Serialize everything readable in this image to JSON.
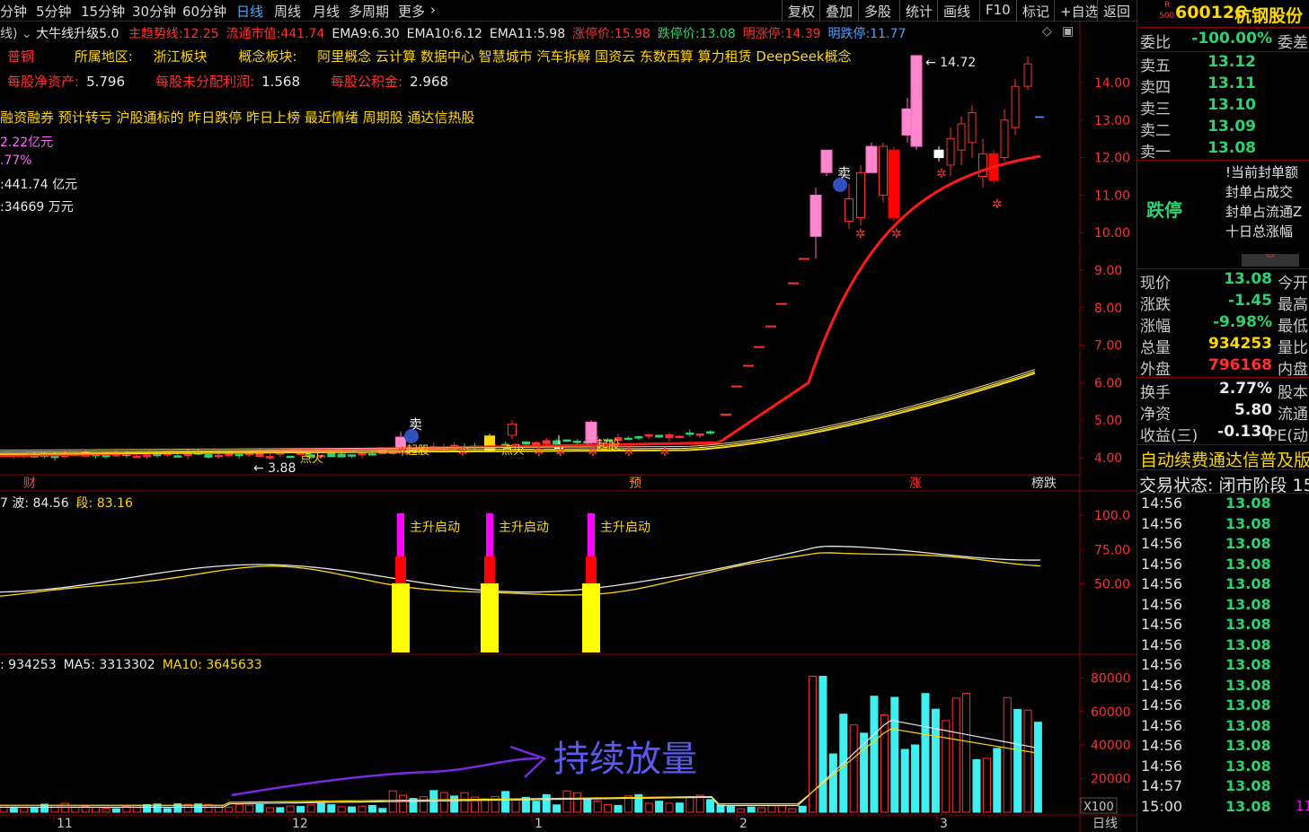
{
  "toolbar": {
    "periods": [
      "分钟",
      "5分钟",
      "15分钟",
      "30分钟",
      "60分钟",
      "日线",
      "周线",
      "月线",
      "多周期",
      "更多"
    ],
    "active_period": "日线",
    "more_icon": "chevron-right-icon",
    "right_buttons": [
      "复权",
      "叠加",
      "多股",
      "统计",
      "画线",
      "F10",
      "标记",
      "+自选",
      "返回"
    ]
  },
  "info_line": {
    "prefix": "线)",
    "indicator_name": "大牛线升级5.0",
    "items": [
      {
        "label": "主趋势线: ",
        "value": "12.25",
        "color": "#ff3030"
      },
      {
        "label": "流通市值: ",
        "value": "441.74",
        "color": "#ff3030"
      },
      {
        "label": "EMA9: ",
        "value": "6.30",
        "color": "#e8e8e8"
      },
      {
        "label": "EMA10: ",
        "value": "6.12",
        "color": "#e8e8e8"
      },
      {
        "label": "EMA11: ",
        "value": "5.98",
        "color": "#e8e8e8"
      },
      {
        "label": "涨停价: ",
        "value": "15.98",
        "color": "#ff3030"
      },
      {
        "label": "跌停价: ",
        "value": "13.08",
        "color": "#2dd36f"
      },
      {
        "label": "明涨停: ",
        "value": "14.39",
        "color": "#ff3030"
      },
      {
        "label": "明跌停: ",
        "value": "11.77",
        "color": "#4fa3ff"
      }
    ]
  },
  "overlay": {
    "sector_row": {
      "stock_short": "普钢",
      "region_label": "所属地区:",
      "region": "浙江板块",
      "concept_label": "概念板块:",
      "concepts": "阿里概念 云计算 数据中心 智慧城市 汽车拆解 国资云 东数西算 算力租赁 DeepSeek概念"
    },
    "fin_row": [
      {
        "label": "每股净资产:",
        "value": "5.796"
      },
      {
        "label": "每股未分配利润:",
        "value": "1.568"
      },
      {
        "label": "每股公积金:",
        "value": "2.968"
      }
    ],
    "tags": "融资融券 预计转亏 沪股通标的 昨日跌停 昨日上榜 最近情绪 周期股 通达信热股",
    "left_lines": [
      "2.22亿元",
      ".77%",
      ":441.74 亿元",
      ":34669 万元"
    ]
  },
  "main_chart": {
    "y_ticks": [
      "14.00",
      "13.00",
      "12.00",
      "11.00",
      "10.00",
      "9.00",
      "8.00",
      "7.00",
      "6.00",
      "5.00",
      "4.00"
    ],
    "high_label": "14.72",
    "low_label": "3.88",
    "sell_marks": [
      "卖",
      "卖"
    ],
    "dianhuo": [
      "点火",
      "点火"
    ],
    "qibu": [
      "起股",
      "起股"
    ],
    "event_marks": [
      {
        "text": "财",
        "color": "#ff4444"
      },
      {
        "text": "预",
        "color": "#ff8c00"
      },
      {
        "text": "涨",
        "color": "#ff3030"
      },
      {
        "text": "榜跌",
        "color": "#d8d8d8"
      }
    ]
  },
  "osc_panel": {
    "header": [
      {
        "label": "7 波: ",
        "value": "84.56",
        "color": "#e8e8e8"
      },
      {
        "label": "段: ",
        "value": "83.16",
        "color": "#ffd700"
      }
    ],
    "y_ticks": [
      "100.0",
      "75.00",
      "50.00"
    ],
    "signals": [
      "主升启动",
      "主升启动",
      "主升启动"
    ]
  },
  "vol_panel": {
    "header": [
      {
        "label": ": ",
        "value": "934253",
        "color": "#e8e8e8"
      },
      {
        "label": "MA5: ",
        "value": "3313302",
        "color": "#e8e8e8"
      },
      {
        "label": "MA10: ",
        "value": "3645633",
        "color": "#ffd700"
      }
    ],
    "y_ticks": [
      "80000",
      "60000",
      "40000",
      "20000"
    ],
    "unit": "X100",
    "annotation": "持续放量"
  },
  "x_axis": {
    "labels": [
      "11",
      "12",
      "1",
      "2",
      "3"
    ],
    "period_label": "日线"
  },
  "right_panel": {
    "badge_top": "R",
    "badge_bottom": "500",
    "code": "600126",
    "name": "杭钢股份",
    "weibi": {
      "label": "委比",
      "value": "-100.00%",
      "extra": "委差"
    },
    "asks": [
      {
        "label": "卖五",
        "price": "13.12"
      },
      {
        "label": "卖四",
        "price": "13.11"
      },
      {
        "label": "卖三",
        "price": "13.10"
      },
      {
        "label": "卖二",
        "price": "13.09"
      },
      {
        "label": "卖一",
        "price": "13.08"
      }
    ],
    "limit_status": "跌停",
    "seal_items": [
      "!当前封单额",
      "封单占成交",
      "封单占流通Z",
      "十日总涨幅"
    ],
    "quote": [
      {
        "label": "现价",
        "value": "13.08",
        "color": "#2dd36f",
        "right": "今开"
      },
      {
        "label": "涨跌",
        "value": "-1.45",
        "color": "#2dd36f",
        "right": "最高"
      },
      {
        "label": "涨幅",
        "value": "-9.98%",
        "color": "#2dd36f",
        "right": "最低"
      },
      {
        "label": "总量",
        "value": "934253",
        "color": "#ffd700",
        "right": "量比"
      },
      {
        "label": "外盘",
        "value": "796168",
        "color": "#ff3030",
        "right": "内盘"
      }
    ],
    "fund": [
      {
        "label": "换手",
        "value": "2.77%",
        "right": "股本"
      },
      {
        "label": "净资",
        "value": "5.80",
        "right": "流通"
      },
      {
        "label": "收益(三)",
        "value": "-0.130",
        "right": "PE(动"
      }
    ],
    "notice": "自动续费通达信普及版",
    "trade_state": "交易状态: 闭市阶段 15",
    "ticks": [
      {
        "time": "14:56",
        "price": "13.08"
      },
      {
        "time": "14:56",
        "price": "13.08"
      },
      {
        "time": "14:56",
        "price": "13.08"
      },
      {
        "time": "14:56",
        "price": "13.08"
      },
      {
        "time": "14:56",
        "price": "13.08"
      },
      {
        "time": "14:56",
        "price": "13.08"
      },
      {
        "time": "14:56",
        "price": "13.08"
      },
      {
        "time": "14:56",
        "price": "13.08"
      },
      {
        "time": "14:56",
        "price": "13.08"
      },
      {
        "time": "14:56",
        "price": "13.08"
      },
      {
        "time": "14:56",
        "price": "13.08"
      },
      {
        "time": "14:56",
        "price": "13.08"
      },
      {
        "time": "14:56",
        "price": "13.08"
      },
      {
        "time": "14:56",
        "price": "13.08"
      },
      {
        "time": "14:57",
        "price": "13.08"
      },
      {
        "time": "15:00",
        "price": "13.08",
        "extra": "11"
      }
    ]
  }
}
